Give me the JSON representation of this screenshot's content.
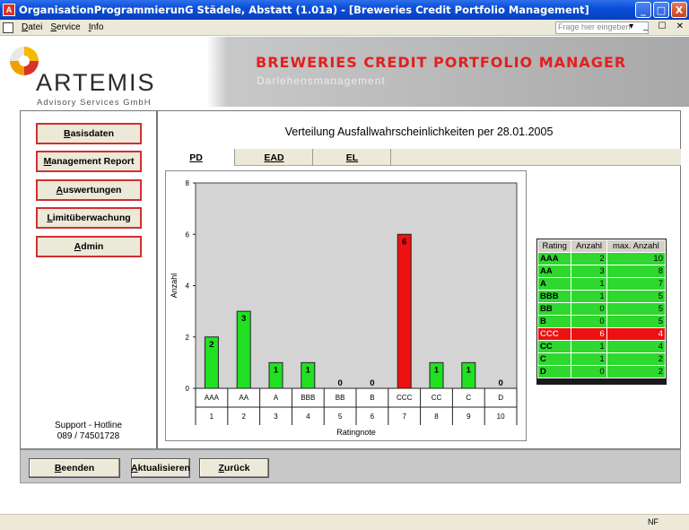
{
  "window": {
    "title": "OrganisationProgrammierunG Städele, Abstatt (1.01a) - [Breweries Credit Portfolio Management]",
    "minimize": "_",
    "maximize": "□",
    "close": "X"
  },
  "menu": {
    "items": [
      "Datei",
      "Service",
      "Info"
    ],
    "help_placeholder": "Frage hier eingeben",
    "mdi_controls": "▾ _ ☐ ✕"
  },
  "banner": {
    "logo_name": "ARTEMIS",
    "logo_sub": "Advisory Services GmbH",
    "title": "BREWERIES CREDIT PORTFOLIO MANAGER",
    "subtitle": "Darlehensmanagement",
    "colors": {
      "accent_red": "#e02020",
      "logo_yellow": "#f5b800",
      "logo_red": "#d8322a"
    }
  },
  "nav": {
    "buttons": [
      "Basisdaten",
      "Management Report",
      "Auswertungen",
      "Limitüberwachung",
      "Admin"
    ],
    "support_line1": "Support - Hotline",
    "support_line2": "089 / 74501728"
  },
  "main": {
    "title": "Verteilung Ausfallwahrscheinlichkeiten per 28.01.2005",
    "tabs": [
      "PD",
      "EAD",
      "EL"
    ],
    "active_tab": "PD"
  },
  "chart_data": {
    "type": "bar",
    "categories": [
      "AAA",
      "AA",
      "A",
      "BBB",
      "BB",
      "B",
      "CCC",
      "CC",
      "C",
      "D"
    ],
    "category_numbers": [
      "1",
      "2",
      "3",
      "4",
      "5",
      "6",
      "7",
      "8",
      "9",
      "10"
    ],
    "values": [
      2,
      3,
      1,
      1,
      0,
      0,
      6,
      1,
      1,
      0
    ],
    "bar_colors": [
      "#22e022",
      "#22e022",
      "#22e022",
      "#22e022",
      "#22e022",
      "#22e022",
      "#ee1111",
      "#22e022",
      "#22e022",
      "#22e022"
    ],
    "xlabel": "Ratingnote",
    "ylabel": "Anzahl",
    "ylim": [
      0,
      8
    ],
    "yticks": [
      0,
      2,
      4,
      6,
      8
    ],
    "plot_background": "#d4d4d4",
    "grid": false
  },
  "rating_table": {
    "headers": [
      "Rating",
      "Anzahl",
      "max. Anzahl"
    ],
    "rows": [
      {
        "rating": "AAA",
        "anzahl": "2",
        "max": "10",
        "alert": false
      },
      {
        "rating": "AA",
        "anzahl": "3",
        "max": "8",
        "alert": false
      },
      {
        "rating": "A",
        "anzahl": "1",
        "max": "7",
        "alert": false
      },
      {
        "rating": "BBB",
        "anzahl": "1",
        "max": "5",
        "alert": false
      },
      {
        "rating": "BB",
        "anzahl": "0",
        "max": "5",
        "alert": false
      },
      {
        "rating": "B",
        "anzahl": "0",
        "max": "5",
        "alert": false
      },
      {
        "rating": "CCC",
        "anzahl": "6",
        "max": "4",
        "alert": true
      },
      {
        "rating": "CC",
        "anzahl": "1",
        "max": "4",
        "alert": false
      },
      {
        "rating": "C",
        "anzahl": "1",
        "max": "2",
        "alert": false
      },
      {
        "rating": "D",
        "anzahl": "0",
        "max": "2",
        "alert": false
      }
    ]
  },
  "bottom": {
    "buttons": [
      "Beenden",
      "Aktualisieren",
      "Zurück"
    ]
  },
  "status": {
    "right_text": "NF"
  }
}
